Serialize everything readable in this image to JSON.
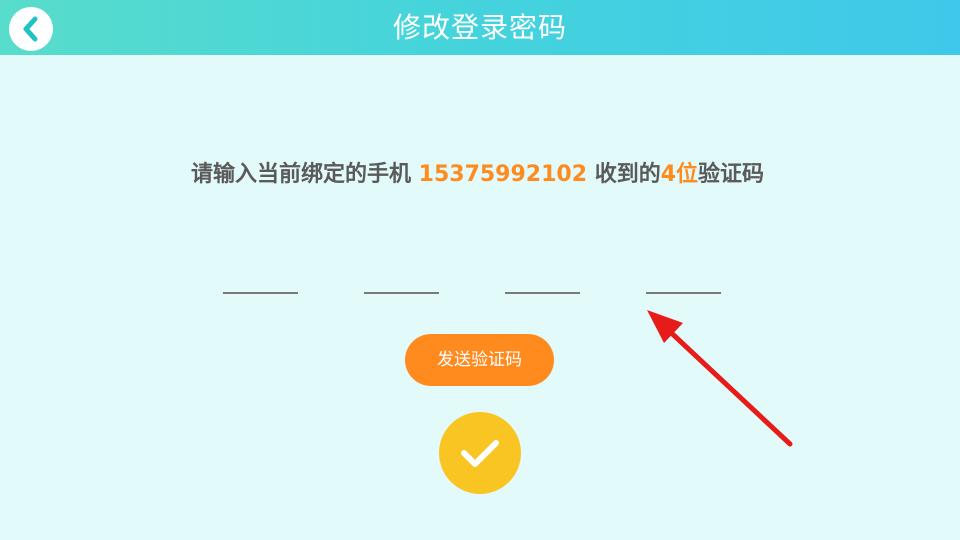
{
  "header": {
    "title": "修改登录密码",
    "back_icon": "chevron-left-icon"
  },
  "prompt": {
    "text_before_phone": "请输入当前绑定的手机 ",
    "phone_number": "15375992102",
    "text_middle": " 收到的",
    "digit_count": "4位",
    "text_after": "验证码"
  },
  "code_input": {
    "slots": [
      "",
      "",
      "",
      ""
    ]
  },
  "buttons": {
    "send_code_label": "发送验证码",
    "confirm_icon": "checkmark-icon"
  },
  "colors": {
    "background": "#e3fafa",
    "header_gradient_start": "#58dccb",
    "header_gradient_end": "#40c8ea",
    "accent_orange": "#ff8a1e",
    "confirm_yellow": "#f8c523",
    "annotation_red": "#e81b1b"
  }
}
